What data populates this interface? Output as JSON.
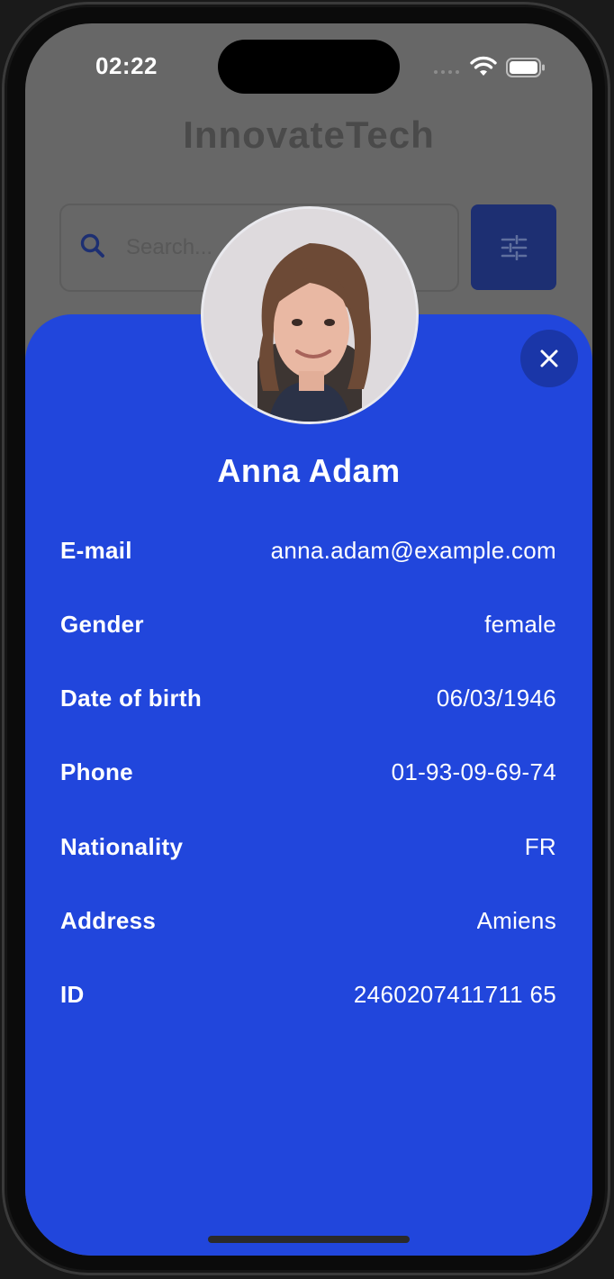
{
  "status_bar": {
    "time": "02:22"
  },
  "app": {
    "title": "InnovateTech"
  },
  "search": {
    "placeholder": "Search..."
  },
  "profile": {
    "name": "Anna Adam",
    "fields": [
      {
        "label": "E-mail",
        "value": "anna.adam@example.com"
      },
      {
        "label": "Gender",
        "value": "female"
      },
      {
        "label": "Date of birth",
        "value": "06/03/1946"
      },
      {
        "label": "Phone",
        "value": "01-93-09-69-74"
      },
      {
        "label": "Nationality",
        "value": "FR"
      },
      {
        "label": "Address",
        "value": "Amiens"
      },
      {
        "label": "ID",
        "value": "2460207411711 65"
      }
    ]
  },
  "icons": {
    "search": "search-icon",
    "filter": "sliders-icon",
    "close": "close-icon",
    "wifi": "wifi-icon",
    "battery": "battery-icon"
  },
  "colors": {
    "sheet": "#2146dc",
    "close_button": "#1a36a8",
    "filter_button": "#1d2f72",
    "overlay": "#676767"
  }
}
